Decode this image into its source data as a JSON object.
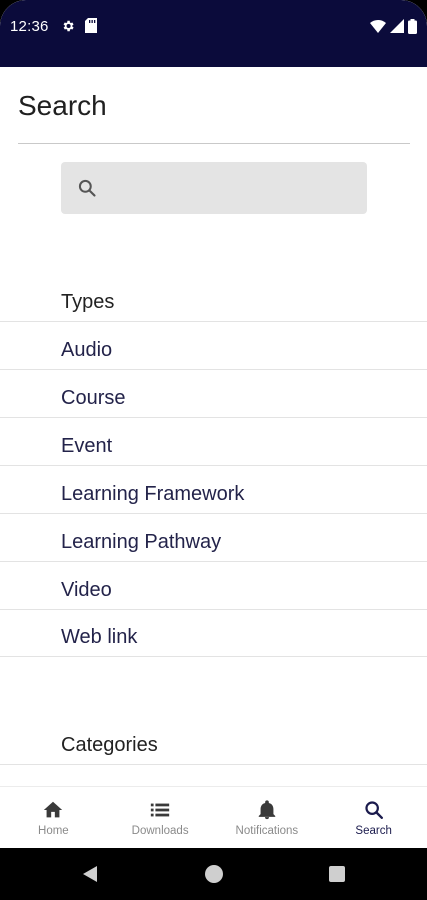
{
  "status_bar": {
    "time": "12:36",
    "icons_left": [
      "gear-icon",
      "sd-card-icon"
    ],
    "icons_right": [
      "wifi-icon",
      "signal-icon",
      "battery-icon"
    ]
  },
  "header": {
    "title": "Search"
  },
  "search": {
    "placeholder": "",
    "value": ""
  },
  "filters": {
    "types_header": "Types",
    "types": [
      "Audio",
      "Course",
      "Event",
      "Learning Framework",
      "Learning Pathway",
      "Video",
      "Web link"
    ],
    "categories_header": "Categories"
  },
  "bottom_nav": {
    "items": [
      {
        "label": "Home",
        "icon": "home-icon",
        "active": false
      },
      {
        "label": "Downloads",
        "icon": "list-icon",
        "active": false
      },
      {
        "label": "Notifications",
        "icon": "bell-icon",
        "active": false
      },
      {
        "label": "Search",
        "icon": "search-icon",
        "active": true
      }
    ]
  },
  "colors": {
    "status_bar": "#0b0b3b",
    "accent": "#1b1b4d",
    "search_bg": "#e4e4e4",
    "inactive_nav": "#8a8a8a"
  }
}
